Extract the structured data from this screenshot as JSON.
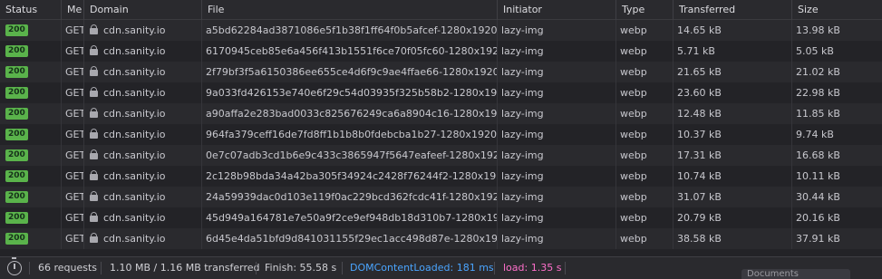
{
  "columns": {
    "status": "Status",
    "method": "Me",
    "domain": "Domain",
    "file": "File",
    "initiator": "Initiator",
    "type": "Type",
    "transferred": "Transferred",
    "size": "Size"
  },
  "rows": [
    {
      "status": "200",
      "method": "GET",
      "domain": "cdn.sanity.io",
      "file": "a5bd62284ad3871086e5f1b38f1ff64f0b5afcef-1280x1920.jpg?w",
      "initiator": "lazy-img",
      "type": "webp",
      "transferred": "14.65 kB",
      "size": "13.98 kB"
    },
    {
      "status": "200",
      "method": "GET",
      "domain": "cdn.sanity.io",
      "file": "6170945ceb85e6a456f413b1551f6ce70f05fc60-1280x1920.jpg?w",
      "initiator": "lazy-img",
      "type": "webp",
      "transferred": "5.71 kB",
      "size": "5.05 kB"
    },
    {
      "status": "200",
      "method": "GET",
      "domain": "cdn.sanity.io",
      "file": "2f79bf3f5a6150386ee655ce4d6f9c9ae4ffae66-1280x1920.jpg?w",
      "initiator": "lazy-img",
      "type": "webp",
      "transferred": "21.65 kB",
      "size": "21.02 kB"
    },
    {
      "status": "200",
      "method": "GET",
      "domain": "cdn.sanity.io",
      "file": "9a033fd426153e740e6f29c54d03935f325b58b2-1280x1920.jpg?w",
      "initiator": "lazy-img",
      "type": "webp",
      "transferred": "23.60 kB",
      "size": "22.98 kB"
    },
    {
      "status": "200",
      "method": "GET",
      "domain": "cdn.sanity.io",
      "file": "a90affa2e283bad0033c825676249ca6a8904c16-1280x1920.jpg?w",
      "initiator": "lazy-img",
      "type": "webp",
      "transferred": "12.48 kB",
      "size": "11.85 kB"
    },
    {
      "status": "200",
      "method": "GET",
      "domain": "cdn.sanity.io",
      "file": "964fa379ceff16de7fd8ff1b1b8b0fdebcba1b27-1280x1920.jpg?w",
      "initiator": "lazy-img",
      "type": "webp",
      "transferred": "10.37 kB",
      "size": "9.74 kB"
    },
    {
      "status": "200",
      "method": "GET",
      "domain": "cdn.sanity.io",
      "file": "0e7c07adb3cd1b6e9c433c3865947f5647eafeef-1280x1920.png?w",
      "initiator": "lazy-img",
      "type": "webp",
      "transferred": "17.31 kB",
      "size": "16.68 kB"
    },
    {
      "status": "200",
      "method": "GET",
      "domain": "cdn.sanity.io",
      "file": "2c128b98bda34a42ba305f34924c2428f76244f2-1280x1920.jpg?w",
      "initiator": "lazy-img",
      "type": "webp",
      "transferred": "10.74 kB",
      "size": "10.11 kB"
    },
    {
      "status": "200",
      "method": "GET",
      "domain": "cdn.sanity.io",
      "file": "24a59939dac0d103e119f0ac229bcd362fcdc41f-1280x1920.jpg?w",
      "initiator": "lazy-img",
      "type": "webp",
      "transferred": "31.07 kB",
      "size": "30.44 kB"
    },
    {
      "status": "200",
      "method": "GET",
      "domain": "cdn.sanity.io",
      "file": "45d949a164781e7e50a9f2ce9ef948db18d310b7-1280x1920.jpg?w",
      "initiator": "lazy-img",
      "type": "webp",
      "transferred": "20.79 kB",
      "size": "20.16 kB"
    },
    {
      "status": "200",
      "method": "GET",
      "domain": "cdn.sanity.io",
      "file": "6d45e4da51bfd9d841031155f29ec1acc498d87e-1280x1920.jpg?w",
      "initiator": "lazy-img",
      "type": "webp",
      "transferred": "38.58 kB",
      "size": "37.91 kB"
    }
  ],
  "footer": {
    "requests": "66 requests",
    "transferred": "1.10 MB / 1.16 MB transferred",
    "finish": "Finish: 55.58 s",
    "domcontentloaded": "DOMContentLoaded: 181 ms",
    "load": "load: 1.35 s",
    "hidden_tab": "Documents"
  },
  "colors": {
    "status_ok": "#5ab34b",
    "domcontentloaded": "#4aa5ff",
    "load": "#ff6fcb"
  },
  "icons": {
    "secure": "lock-icon",
    "performance": "timer-icon"
  }
}
